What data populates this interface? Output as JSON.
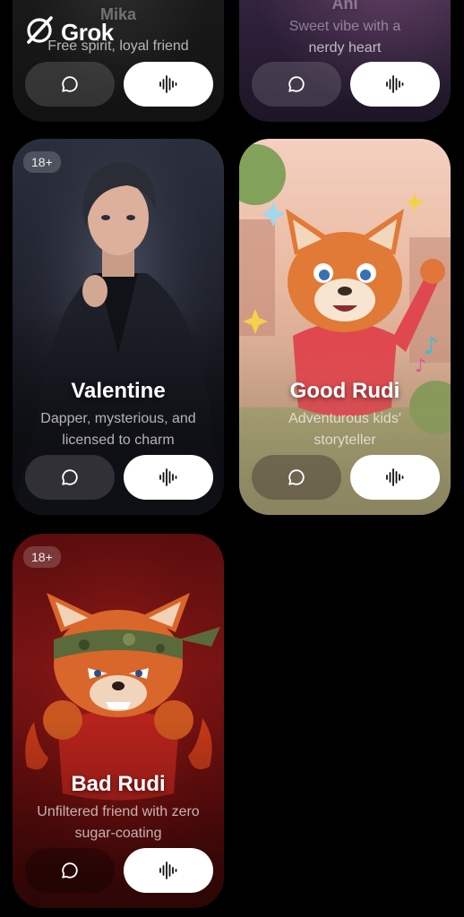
{
  "app": {
    "name": "Grok",
    "logo_icon": "grok-logo-icon"
  },
  "buttons": {
    "chat_icon": "chat-bubble-icon",
    "voice_icon": "soundwave-icon"
  },
  "cards": [
    {
      "title": "Mika",
      "description": "Free spirit, loyal friend"
    },
    {
      "title": "Ani",
      "description_line1": "Sweet vibe with a",
      "description_line2": "nerdy heart"
    },
    {
      "badge": "18+",
      "title": "Valentine",
      "description_line1": "Dapper, mysterious, and",
      "description_line2": "licensed to charm"
    },
    {
      "title": "Good Rudi",
      "description_line1": "Adventurous kids'",
      "description_line2": "storyteller"
    },
    {
      "badge": "18+",
      "title": "Bad Rudi",
      "description_line1": "Unfiltered friend with zero",
      "description_line2": "sugar-coating"
    }
  ]
}
